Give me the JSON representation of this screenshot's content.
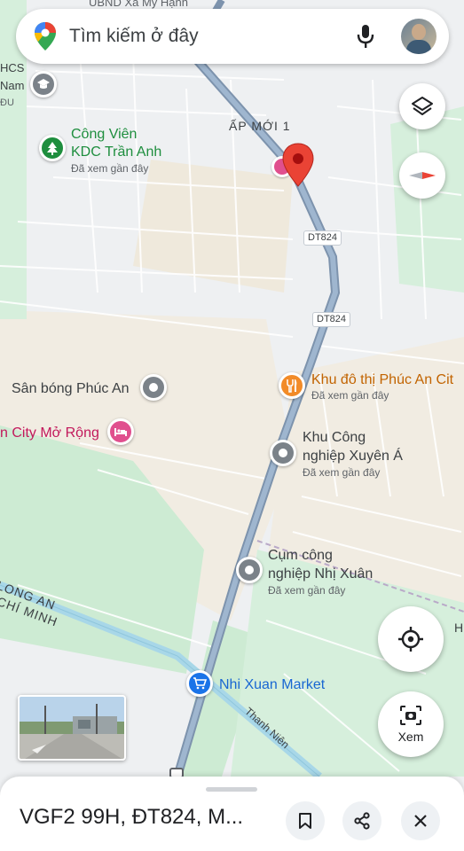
{
  "search": {
    "placeholder": "Tìm kiếm ở đây"
  },
  "map": {
    "top_label": "UBND Xã Mỹ Hạnh",
    "area_label": "ẤP MỚI 1",
    "road_labels": [
      "DT824",
      "DT824"
    ],
    "canal_labels": [
      "LONG AN",
      "CHÍ MINH",
      "Thanh Niên"
    ],
    "edge_labels": [
      "HCS",
      "Nam",
      "ĐU"
    ],
    "visited_text": "Đã xem gần đây",
    "pois": [
      {
        "name_lines": [
          "Công Viên",
          "KDC Trần Anh"
        ],
        "visited": true,
        "icon": "park-icon",
        "color": "#1e8e3e"
      },
      {
        "name_lines": [
          "Khu đô thị Phúc An Cit"
        ],
        "visited": true,
        "icon": "restaurant-icon",
        "color": "#f28b28"
      },
      {
        "name_lines": [
          "Sân bóng Phúc An"
        ],
        "visited": false,
        "icon": "place-icon",
        "color": "#7b8289"
      },
      {
        "name_lines": [
          "n City Mở Rộng"
        ],
        "visited": false,
        "icon": "hotel-icon",
        "color": "#e04f8e"
      },
      {
        "name_lines": [
          "Khu Công",
          "nghiệp Xuyên Á"
        ],
        "visited": true,
        "icon": "place-icon",
        "color": "#7b8289"
      },
      {
        "name_lines": [
          "Cụm công",
          "nghiệp Nhị Xuân"
        ],
        "visited": true,
        "icon": "place-icon",
        "color": "#7b8289"
      },
      {
        "name_lines": [
          "Nhi Xuan Market"
        ],
        "visited": false,
        "icon": "shopping-cart-icon",
        "color": "#1a73e8"
      }
    ],
    "edge_right_letter": "H"
  },
  "controls": {
    "lens_label": "Xem"
  },
  "bottom_sheet": {
    "title": "VGF2 99H, ĐT824, M..."
  },
  "colors": {
    "accent": "#1a73e8",
    "pin_red": "#ea4335",
    "road_main": "#8fa9c4",
    "canal": "#a8d7e8",
    "green_area": "#cdebd3",
    "land": "#f0ebe0"
  }
}
